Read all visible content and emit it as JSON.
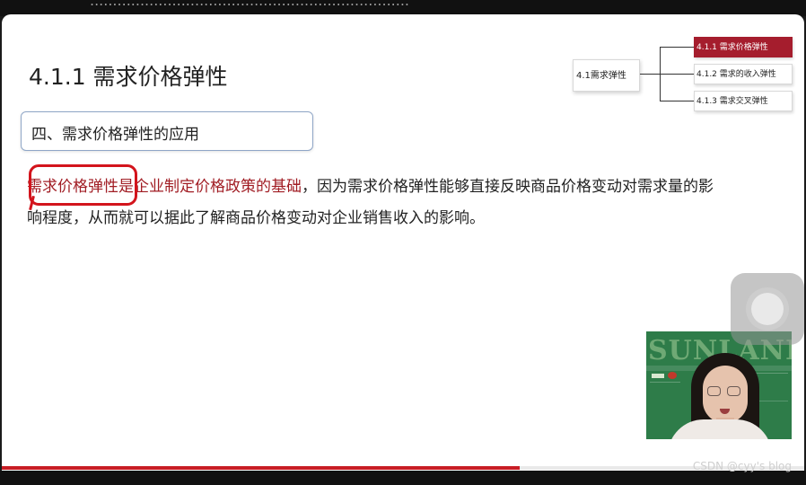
{
  "top_bar": {
    "partial_text": "......................................................................"
  },
  "slide": {
    "title": "4.1.1 需求价格弹性",
    "section_label": "四、需求价格弹性的应用",
    "line1_highlight_a": "需求价格弹性",
    "line1_highlight_b": "是企业制定价格政策的基础",
    "line1_rest": "，因为需求价格弹性能够直接反映商品价格变动对需求量的影",
    "line2": "响程度，从而就可以据此了解商品价格变动对企业销售收入的影响。"
  },
  "mind_map": {
    "root": "4.1需求弹性",
    "nodes": [
      {
        "label": "4.1.1 需求价格弹性",
        "active": true
      },
      {
        "label": "4.1.2 需求的收入弹性",
        "active": false
      },
      {
        "label": "4.1.3 需求交叉弹性",
        "active": false
      }
    ]
  },
  "webcam": {
    "background_text": "SUNLAND"
  },
  "progress": {
    "fraction": 0.645
  },
  "watermark": "CSDN @cyy's blog",
  "colors": {
    "accent_red": "#a51d2d",
    "annotation_red": "#d3141c",
    "progress_red": "#c81d25",
    "section_border": "#8fa6c7"
  },
  "icons": {
    "floating_button": "assistive-touch-icon"
  }
}
